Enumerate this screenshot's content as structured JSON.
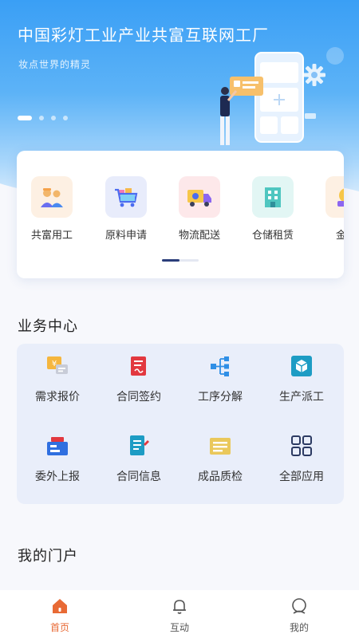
{
  "banner": {
    "title": "中国彩灯工业产业共富互联网工厂",
    "subtitle": "妆点世界的精灵"
  },
  "quick_access": [
    {
      "label": "共富用工",
      "icon": "workers-icon"
    },
    {
      "label": "原料申请",
      "icon": "cart-icon"
    },
    {
      "label": "物流配送",
      "icon": "truck-icon"
    },
    {
      "label": "仓储租赁",
      "icon": "warehouse-icon"
    },
    {
      "label": "金融",
      "icon": "finance-icon"
    }
  ],
  "business": {
    "title": "业务中心",
    "items": [
      {
        "label": "需求报价",
        "icon": "quote-icon"
      },
      {
        "label": "合同签约",
        "icon": "contract-sign-icon"
      },
      {
        "label": "工序分解",
        "icon": "process-tree-icon"
      },
      {
        "label": "生产派工",
        "icon": "production-cube-icon"
      },
      {
        "label": "委外上报",
        "icon": "outsource-icon"
      },
      {
        "label": "合同信息",
        "icon": "contract-info-icon"
      },
      {
        "label": "成品质检",
        "icon": "quality-check-icon"
      },
      {
        "label": "全部应用",
        "icon": "grid-apps-icon"
      }
    ]
  },
  "portal": {
    "title": "我的门户"
  },
  "tabbar": [
    {
      "label": "首页",
      "icon": "home-icon",
      "active": true
    },
    {
      "label": "互动",
      "icon": "bell-icon",
      "active": false
    },
    {
      "label": "我的",
      "icon": "profile-icon",
      "active": false
    }
  ],
  "colors": {
    "primary": "#3a9ff5",
    "accent": "#e86a35",
    "indicator": "#2b3e7a"
  }
}
